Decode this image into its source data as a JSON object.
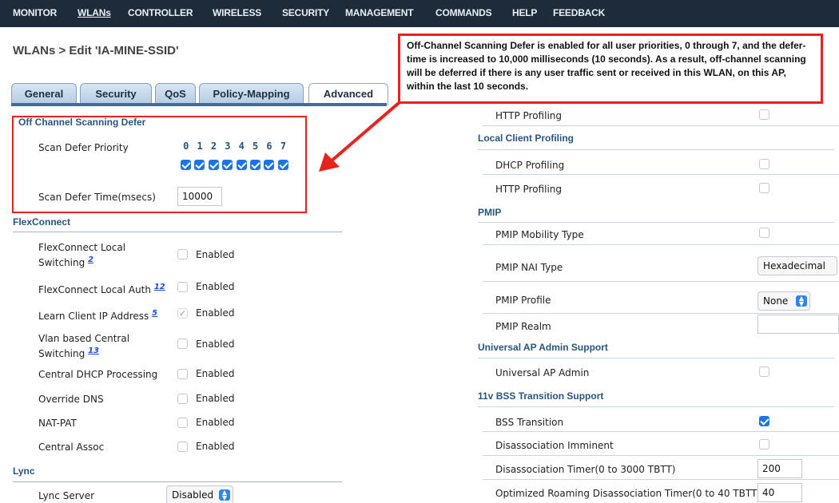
{
  "menu": [
    {
      "label": "MONITOR",
      "underline": false
    },
    {
      "label": "WLANs",
      "underline": true
    },
    {
      "label": "CONTROLLER",
      "underline": false
    },
    {
      "label": "WIRELESS",
      "underline": false
    },
    {
      "label": "SECURITY",
      "underline": false
    },
    {
      "label": "MANAGEMENT",
      "underline": false
    },
    {
      "label": "COMMANDS",
      "underline": false
    },
    {
      "label": "HELP",
      "underline": false
    },
    {
      "label": "FEEDBACK",
      "underline": false
    }
  ],
  "page_title": "WLANs > Edit  'IA-MINE-SSID'",
  "callout": "Off-Channel Scanning Defer is enabled for all user priorities, 0 through 7, and the defer-time is increased to 10,000 milliseconds (10 seconds).  As a result, off-channel scanning will be deferred if there is any user traffic sent or received in this WLAN, on this AP, within the last 10 seconds.",
  "tabs": [
    "General",
    "Security",
    "QoS",
    "Policy-Mapping",
    "Advanced"
  ],
  "ocsd": {
    "title": "Off Channel Scanning Defer",
    "priority_label": "Scan Defer Priority",
    "priorities": [
      "0",
      "1",
      "2",
      "3",
      "4",
      "5",
      "6",
      "7"
    ],
    "time_label": "Scan Defer Time(msecs)",
    "time_value": "10000"
  },
  "flexconnect": {
    "title": "FlexConnect",
    "enabled_text": "Enabled",
    "rows": [
      {
        "label": "FlexConnect Local Switching",
        "fn": "2",
        "checked": false
      },
      {
        "label": "FlexConnect Local Auth",
        "fn": "12",
        "checked": false
      },
      {
        "label": "Learn Client IP Address",
        "fn": "5",
        "checked": true
      },
      {
        "label": "Vlan based Central Switching",
        "fn": "13",
        "checked": false
      },
      {
        "label": "Central DHCP Processing",
        "fn": "",
        "checked": false
      },
      {
        "label": "Override DNS",
        "fn": "",
        "checked": false
      },
      {
        "label": "NAT-PAT",
        "fn": "",
        "checked": false
      },
      {
        "label": "Central Assoc",
        "fn": "",
        "checked": false
      }
    ]
  },
  "lync": {
    "title": "Lync",
    "server_label": "Lync Server",
    "server_value": "Disabled"
  },
  "right": {
    "http_profiling_top": "HTTP Profiling",
    "local_client_title": "Local Client Profiling",
    "dhcp_profiling": "DHCP Profiling",
    "http_profiling": "HTTP Profiling",
    "pmip_title": "PMIP",
    "pmip_mobility": "PMIP Mobility Type",
    "pmip_nai": "PMIP NAI Type",
    "pmip_nai_value": "Hexadecimal",
    "pmip_profile": "PMIP Profile",
    "pmip_profile_value": "None",
    "pmip_realm": "PMIP Realm",
    "uap_title": "Universal AP Admin Support",
    "uap_admin": "Universal AP Admin",
    "bss_title": "11v BSS Transition Support",
    "bss_transition": "BSS Transition",
    "disassoc_imminent": "Disassociation Imminent",
    "disassoc_timer": "Disassociation Timer(0 to 3000 TBTT)",
    "disassoc_timer_value": "200",
    "opt_roam_timer": "Optimized Roaming Disassociation Timer(0 to 40 TBTT)",
    "opt_roam_timer_value": "40"
  },
  "colors": {
    "menubar": "#1d2b3a",
    "accent_red": "#e8221c",
    "section_blue": "#27557f",
    "checkbox_blue": "#1c74e8"
  }
}
